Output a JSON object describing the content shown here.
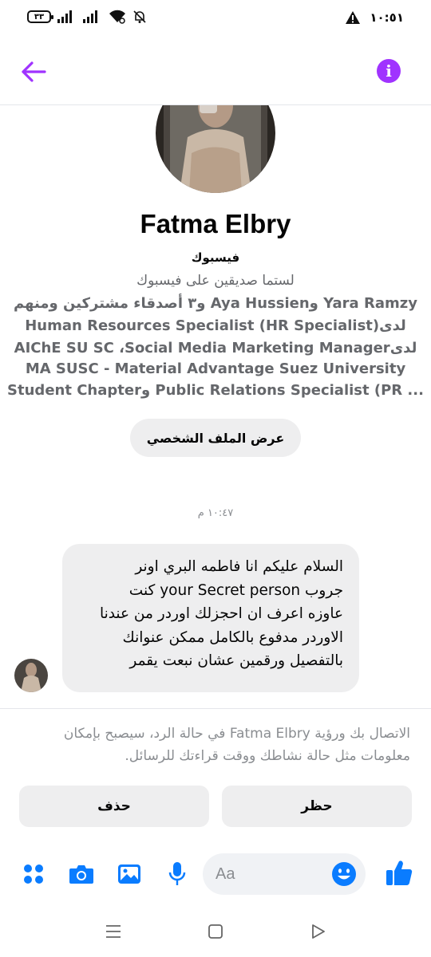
{
  "status_bar": {
    "battery": "٣٣",
    "time": "١٠:٥١"
  },
  "profile": {
    "name": "Fatma Elbry",
    "platform": "فيسبوك",
    "friend_status": "لستما صديقين على فيسبوك",
    "mutual_line": "Yara Ramzy وAya Hussien و٣ أصدقاء مشتركين ومنهم",
    "work_lines": [
      "Human Resources Specialist (HR Specialist)لدى",
      "AIChE SU SC ،Social Media Marketing Managerلدى",
      "MA SUSC - Material Advantage Suez University",
      "Student Chapterو Public Relations Specialist (PR ..."
    ],
    "view_profile_label": "عرض الملف الشخصي"
  },
  "conversation": {
    "timestamp": "١٠:٤٧ م",
    "message_lines": [
      "السلام عليكم انا فاطمه البري اونر",
      "جروب your Secret person كنت",
      "عاوزه اعرف ان احجزلك اوردر من عندنا",
      "الاوردر مدفوع بالكامل ممكن عنوانك",
      "بالتفصيل ورقمين عشان نبعت يقمر"
    ]
  },
  "request_notice": {
    "lines": [
      "الاتصال بك ورؤية Fatma Elbry في حالة الرد، سيصبح بإمكان",
      "معلومات مثل حالة نشاطك ووقت قراءتك للرسائل."
    ]
  },
  "actions": {
    "delete_label": "حذف",
    "block_label": "حظر"
  },
  "composer": {
    "placeholder": "Aa"
  },
  "colors": {
    "accent": "#a033ff",
    "messenger_blue": "#0a7cff",
    "bubble_bg": "#eeeeef"
  }
}
